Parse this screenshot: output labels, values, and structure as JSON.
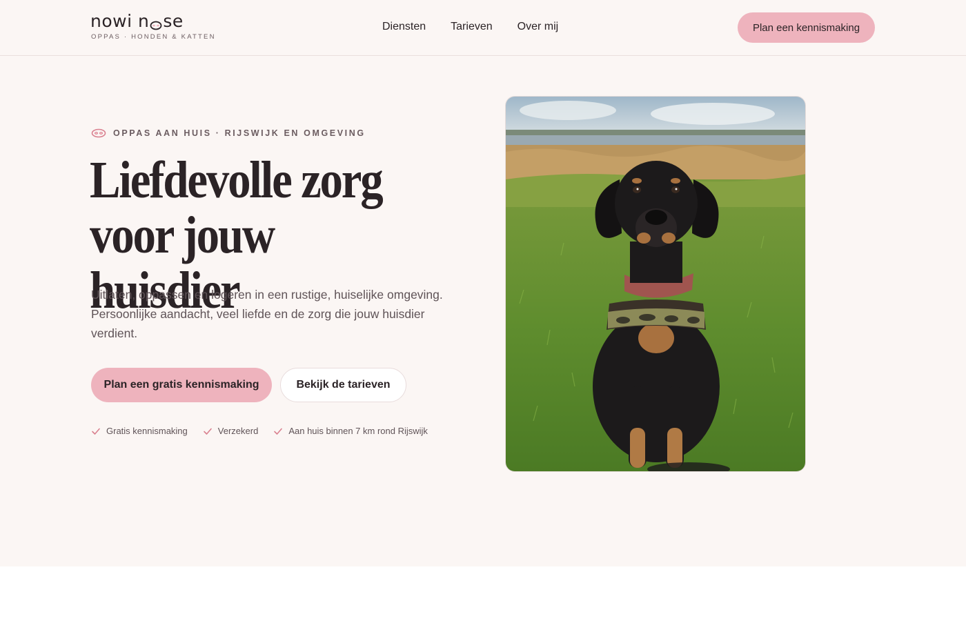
{
  "brand": {
    "name_part1": "nowi n",
    "name_part2": "se",
    "tagline": "OPPAS · HONDEN & KATTEN"
  },
  "nav": {
    "items": [
      "Diensten",
      "Tarieven",
      "Over mij"
    ]
  },
  "header_cta": "Plan een kennismaking",
  "hero": {
    "eyebrow": "OPPAS AAN HUIS · RIJSWIJK EN OMGEVING",
    "headline_line1": "Liefdevolle zorg",
    "headline_line2": "voor jouw huisdier",
    "lead": "Uitlaten, oppassen en logeren in een rustige, huiselijke omgeving. Persoonlijke aandacht, veel liefde en de zorg die jouw huisdier verdient.",
    "primary_button": "Plan een gratis kennismaking",
    "secondary_button": "Bekijk de tarieven",
    "checks": [
      "Gratis kennismaking",
      "Verzekerd",
      "Aan huis binnen 7 km rond Rijswijk"
    ]
  },
  "colors": {
    "background": "#fbf6f4",
    "accent_pink": "#eeb3bd",
    "text_dark": "#2b2326",
    "text_muted": "#5f5357",
    "check_pink": "#d9808f"
  },
  "icons": {
    "logo_nose": "dog-nose-icon",
    "eyebrow": "dog-nose-icon",
    "check": "checkmark-icon"
  }
}
